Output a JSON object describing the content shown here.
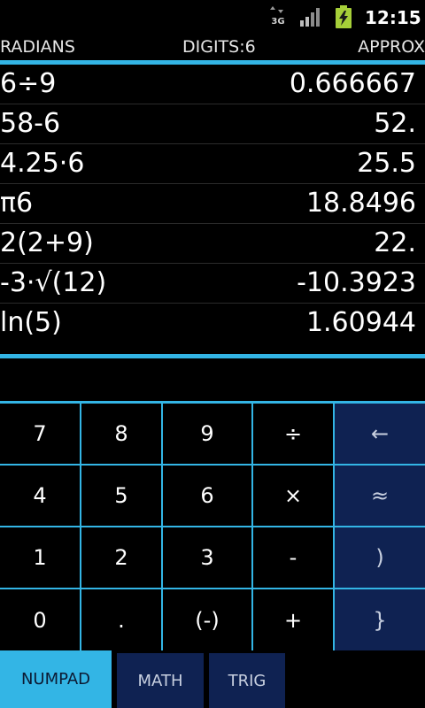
{
  "status": {
    "network": "3G",
    "clock": "12:15",
    "icons": [
      "3g-data-icon",
      "signal-icon",
      "battery-charging-icon"
    ]
  },
  "mode": {
    "angle": "RADIANS",
    "digits": "DIGITS:6",
    "approx": "APPROX"
  },
  "history": [
    {
      "expr": "6÷9",
      "result": "0.666667"
    },
    {
      "expr": "58-6",
      "result": "52."
    },
    {
      "expr": "4.25·6",
      "result": "25.5"
    },
    {
      "expr": "π6",
      "result": "18.8496"
    },
    {
      "expr": "2(2+9)",
      "result": "22."
    },
    {
      "expr": "-3·√(12)",
      "result": "-10.3923"
    },
    {
      "expr": "ln(5)",
      "result": "1.60944"
    }
  ],
  "input": {
    "value": ""
  },
  "keypad": {
    "rows": [
      [
        "7",
        "8",
        "9",
        "÷",
        "←"
      ],
      [
        "4",
        "5",
        "6",
        "×",
        "≈"
      ],
      [
        "1",
        "2",
        "3",
        "-",
        ")"
      ],
      [
        "0",
        ".",
        "(-)",
        "+",
        "}"
      ]
    ]
  },
  "tabs": [
    {
      "label": "NUMPAD",
      "active": true
    },
    {
      "label": "MATH",
      "active": false
    },
    {
      "label": "TRIG",
      "active": false
    }
  ],
  "colors": {
    "accent": "#33b5e5",
    "function_key": "#0f2252",
    "background": "#000000"
  }
}
